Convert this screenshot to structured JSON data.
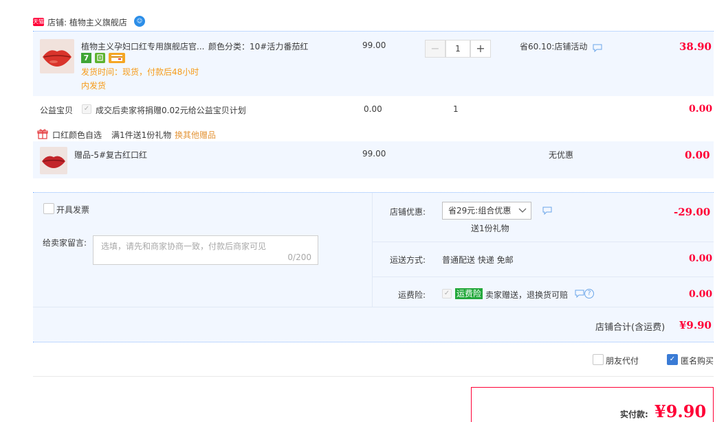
{
  "store": {
    "label": "店铺: 植物主义旗舰店",
    "logo_text": "天猫"
  },
  "item": {
    "title": "植物主义孕妇口红专用旗舰店官...",
    "spec": "颜色分类：10#活力番茄红",
    "ship_time": "发货时间：现货，付款后48小时",
    "ship_time2": "内发货",
    "badge_7": "7",
    "unit_price": "99.00",
    "quantity": "1",
    "discount": "省60.10:店铺活动",
    "subtotal": "38.90"
  },
  "charity": {
    "label": "公益宝贝",
    "desc": "成交后卖家将捐赠0.02元给公益宝贝计划",
    "price": "0.00",
    "qty": "1",
    "subtotal": "0.00"
  },
  "gift_promo": {
    "title": "口红颜色自选",
    "rule": "满1件送1份礼物",
    "link": "换其他赠品"
  },
  "gift_item": {
    "title": "赠品-5#复古红口红",
    "price": "99.00",
    "discount": "无优惠",
    "subtotal": "0.00"
  },
  "invoice": {
    "label": "开具发票"
  },
  "message": {
    "label": "给卖家留言:",
    "placeholder": "选填，请先和商家协商一致，付款后商家可见",
    "counter": "0/200"
  },
  "shop_discount": {
    "label": "店铺优惠:",
    "selected": "省29元:组合优惠",
    "gift_note": "送1份礼物",
    "amount": "-29.00"
  },
  "shipping": {
    "label": "运送方式:",
    "value": "普通配送 快递 免邮",
    "amount": "0.00"
  },
  "insurance": {
    "label": "运费险:",
    "tag": "运费险",
    "desc": "卖家赠送，退换货可赔",
    "amount": "0.00"
  },
  "store_total": {
    "label": "店铺合计(含运费)",
    "amount": "¥9.90"
  },
  "options": {
    "friend_pay": "朋友代付",
    "anonymous": "匿名购买"
  },
  "payment": {
    "label": "实付款:",
    "amount": "¥9.90"
  },
  "colors": {
    "price_red": "#ff0036",
    "link_orange": "#f69b18",
    "panel_blue": "#f2f7ff",
    "accent_blue": "#3a7bd5",
    "insurance_green": "#22a83b"
  }
}
